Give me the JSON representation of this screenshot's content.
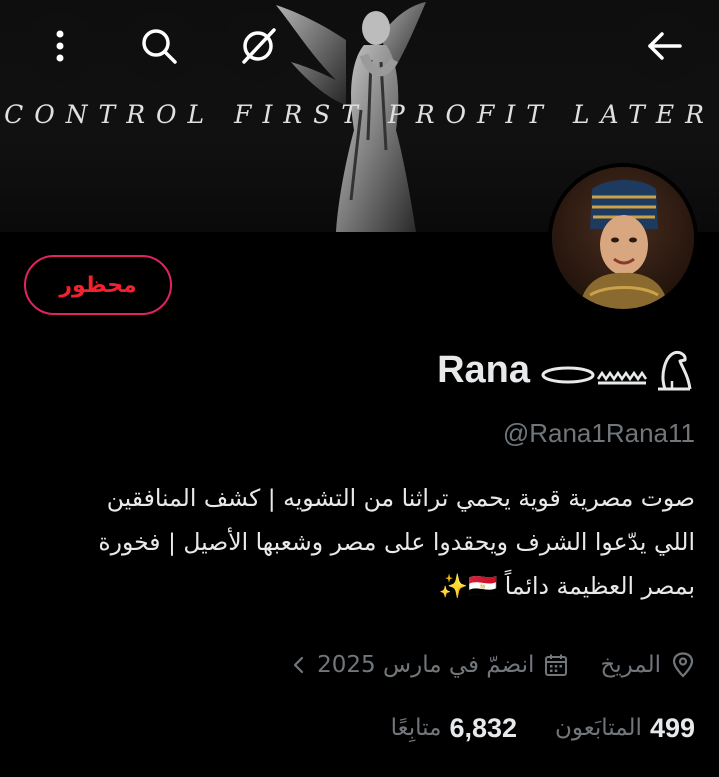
{
  "banner": {
    "text": "CONTROL FIRST PROFIT LATER"
  },
  "actions": {
    "more_icon": "more-vertical-icon",
    "search_icon": "search-icon",
    "grok_icon": "grok-icon",
    "back_icon": "arrow-left-icon"
  },
  "profile": {
    "blocked_label": "محظور",
    "display_name": "Rana",
    "handle": "@Rana1Rana11",
    "bio_line1": "صوت مصرية قوية يحمي تراثنا من التشويه | كشف المنافقين",
    "bio_line2": "اللي يدّعوا الشرف ويحقدوا على مصر وشعبها الأصيل | فخورة",
    "bio_line3": "بمصر العظيمة دائماً 🇪🇬✨",
    "location": "المريخ",
    "joined": "انضمّ في مارس 2025"
  },
  "stats": {
    "following_count": "6,832",
    "following_label": "متابِعًا",
    "followers_count": "499",
    "followers_label": "المتابَعون"
  },
  "colors": {
    "background": "#000000",
    "text": "#e7e9ea",
    "muted": "#71767b",
    "blocked": "#f4212e"
  }
}
